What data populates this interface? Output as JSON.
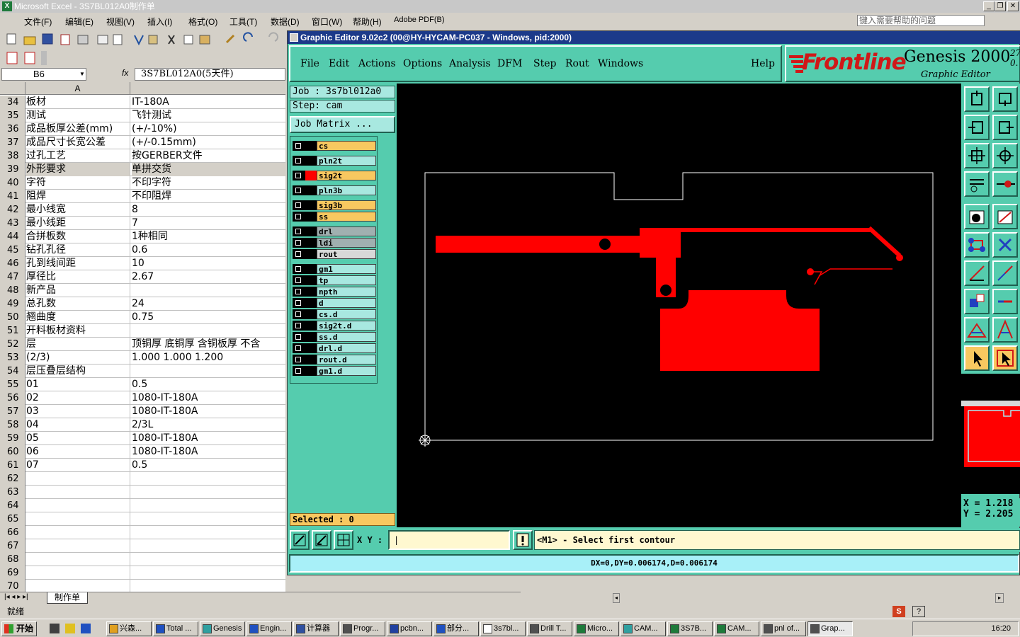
{
  "excel": {
    "title": "Microsoft Excel - 3S7BL012A0制作单",
    "menu": [
      "文件(F)",
      "编辑(E)",
      "视图(V)",
      "插入(I)",
      "格式(O)",
      "工具(T)",
      "数据(D)",
      "窗口(W)",
      "帮助(H)",
      "Adobe PDF(B)"
    ],
    "help_placeholder": "键入需要帮助的问题",
    "name_box": "B6",
    "fx": "fx",
    "formula": "3S7BL012A0(5天件)",
    "col_a": "A",
    "rows": [
      {
        "n": "34",
        "a": "板材",
        "b": "IT-180A"
      },
      {
        "n": "35",
        "a": "测试",
        "b": "飞针测试"
      },
      {
        "n": "36",
        "a": "成品板厚公差(mm)",
        "b": "(+/-10%)"
      },
      {
        "n": "37",
        "a": "成品尺寸长宽公差",
        "b": "(+/-0.15mm)"
      },
      {
        "n": "38",
        "a": "过孔工艺",
        "b": "按GERBER文件"
      },
      {
        "n": "39",
        "a": "外形要求",
        "b": "单拼交货"
      },
      {
        "n": "40",
        "a": "字符",
        "b": "不印字符"
      },
      {
        "n": "41",
        "a": "阻焊",
        "b": "不印阻焊"
      },
      {
        "n": "42",
        "a": "最小线宽",
        "b": "8"
      },
      {
        "n": "43",
        "a": "最小线距",
        "b": "7"
      },
      {
        "n": "44",
        "a": "合拼板数",
        "b": "1种相同"
      },
      {
        "n": "45",
        "a": "钻孔孔径",
        "b": "0.6"
      },
      {
        "n": "46",
        "a": "孔到线间距",
        "b": "10"
      },
      {
        "n": "47",
        "a": "厚径比",
        "b": "2.67"
      },
      {
        "n": "48",
        "a": "新产品",
        "b": ""
      },
      {
        "n": "49",
        "a": "总孔数",
        "b": "24"
      },
      {
        "n": "50",
        "a": "翘曲度",
        "b": "0.75"
      },
      {
        "n": "51",
        "a": "开料板材资料",
        "b": ""
      },
      {
        "n": "52",
        "a": "层",
        "b": "顶铜厚 底铜厚 含铜板厚 不含"
      },
      {
        "n": "53",
        "a": "(2/3)",
        "b": "1.000  1.000   1.200"
      },
      {
        "n": "54",
        "a": "层压叠层结构",
        "b": ""
      },
      {
        "n": "55",
        "a": "01",
        "b": "0.5"
      },
      {
        "n": "56",
        "a": "02",
        "b": "1080-IT-180A"
      },
      {
        "n": "57",
        "a": "03",
        "b": "1080-IT-180A"
      },
      {
        "n": "58",
        "a": "04",
        "b": "2/3L"
      },
      {
        "n": "59",
        "a": "05",
        "b": "1080-IT-180A"
      },
      {
        "n": "60",
        "a": "06",
        "b": "1080-IT-180A"
      },
      {
        "n": "61",
        "a": "07",
        "b": "0.5"
      },
      {
        "n": "62",
        "a": "",
        "b": ""
      },
      {
        "n": "63",
        "a": "",
        "b": ""
      },
      {
        "n": "64",
        "a": "",
        "b": ""
      },
      {
        "n": "65",
        "a": "",
        "b": ""
      },
      {
        "n": "66",
        "a": "",
        "b": ""
      },
      {
        "n": "67",
        "a": "",
        "b": ""
      },
      {
        "n": "68",
        "a": "",
        "b": ""
      },
      {
        "n": "69",
        "a": "",
        "b": ""
      },
      {
        "n": "70",
        "a": "",
        "b": ""
      }
    ],
    "sheet_tab": "制作单",
    "status": "就绪"
  },
  "genesis": {
    "title": "Graphic Editor 9.02c2 (00@HY-HYCAM-PC037 - Windows, pid:2000)",
    "menu": [
      "File",
      "Edit",
      "Actions",
      "Options",
      "Analysis",
      "DFM",
      "Step",
      "Rout",
      "Windows",
      "Help"
    ],
    "logo_brand": "Frontline",
    "logo_product": "Genesis 2000",
    "logo_version": "27 0.",
    "logo_sub": "Graphic Editor",
    "job": "Job  : 3s7bl012a0",
    "step": "Step:  cam",
    "job_matrix": "Job Matrix ...",
    "layers": [
      {
        "name": "cs",
        "color": "#f8c860",
        "swatch": "#000000"
      },
      {
        "name": "pln2t",
        "color": "#a8e8e0",
        "swatch": "#000000"
      },
      {
        "name": "sig2t",
        "color": "#f8c860",
        "swatch": "#ff0000"
      },
      {
        "name": "pln3b",
        "color": "#a8e8e0",
        "swatch": "#000000"
      },
      {
        "name": "sig3b",
        "color": "#f8c860",
        "swatch": "#000000"
      },
      {
        "name": "ss",
        "color": "#f8c860",
        "swatch": "#000000"
      },
      {
        "name": "drl",
        "color": "#a0b0b0",
        "swatch": "#000000"
      },
      {
        "name": "ldi",
        "color": "#a0b0b0",
        "swatch": "#000000"
      },
      {
        "name": "rout",
        "color": "#d8d8d8",
        "swatch": "#000000"
      },
      {
        "name": "gm1",
        "color": "#a8e8e0",
        "swatch": "#000000"
      },
      {
        "name": "tp",
        "color": "#a8e8e0",
        "swatch": "#000000"
      },
      {
        "name": "npth",
        "color": "#a8e8e0",
        "swatch": "#000000"
      },
      {
        "name": "d",
        "color": "#a8e8e0",
        "swatch": "#000000"
      },
      {
        "name": "cs.d",
        "color": "#a8e8e0",
        "swatch": "#000000"
      },
      {
        "name": "sig2t.d",
        "color": "#a8e8e0",
        "swatch": "#000000"
      },
      {
        "name": "ss.d",
        "color": "#a8e8e0",
        "swatch": "#000000"
      },
      {
        "name": "drl.d",
        "color": "#a8e8e0",
        "swatch": "#000000"
      },
      {
        "name": "rout.d",
        "color": "#a8e8e0",
        "swatch": "#000000"
      },
      {
        "name": "gm1.d",
        "color": "#a8e8e0",
        "swatch": "#000000"
      }
    ],
    "selected": "Selected : 0",
    "coord_x": "X = 1.218",
    "coord_y": "Y = 2.205",
    "xy_label": "X Y :",
    "prompt": "<M1> - Select first contour",
    "dx_status": "DX=0,DY=0.006174,D=0.006174",
    "colors": {
      "feature": "#ff0000",
      "profile": "#ffffff",
      "background": "#000000",
      "panel": "#55ccae"
    }
  },
  "taskbar": {
    "start": "开始",
    "items": [
      "兴森...",
      "Total ...",
      "Genesis",
      "Engin...",
      "计算器",
      "Progr...",
      "pcbn...",
      "部分...",
      "3s7bl...",
      "Drill T...",
      "Micro...",
      "CAM...",
      "3S7B...",
      "CAM...",
      "pnl of...",
      "Grap..."
    ],
    "clock": "16:20"
  }
}
